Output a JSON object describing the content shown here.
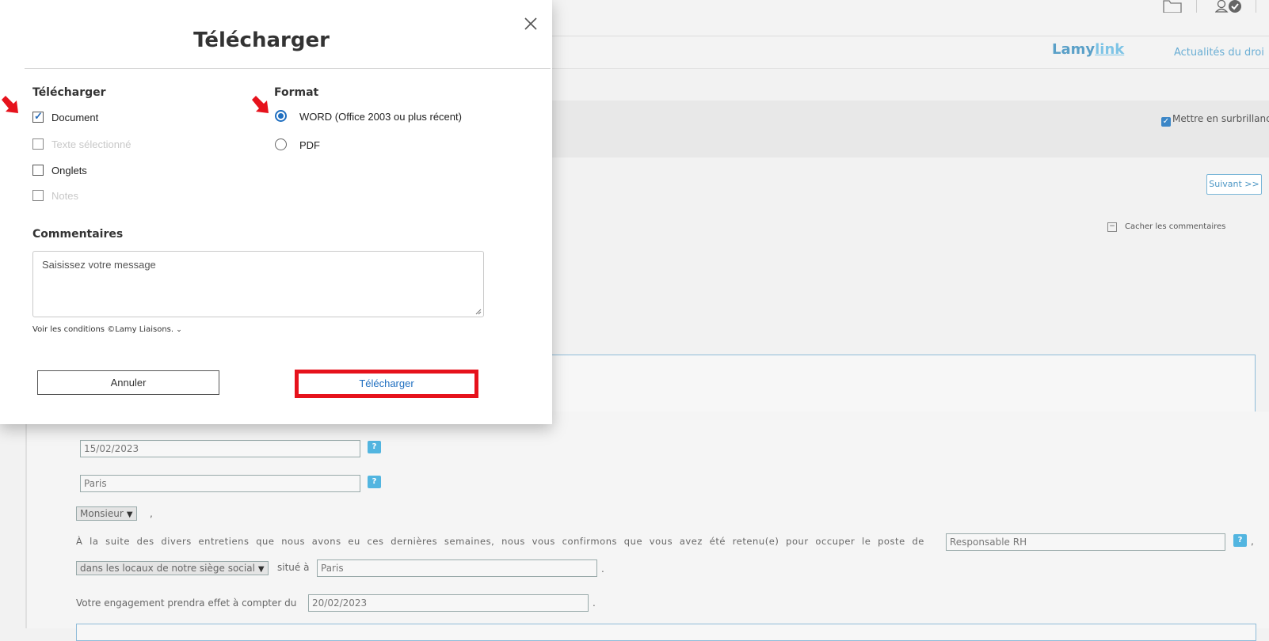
{
  "modal": {
    "title": "Télécharger",
    "download_section": {
      "label": "Télécharger",
      "options": [
        {
          "label": "Document",
          "checked": true,
          "disabled": false
        },
        {
          "label": "Texte sélectionné",
          "checked": false,
          "disabled": true
        },
        {
          "label": "Onglets",
          "checked": false,
          "disabled": false
        },
        {
          "label": "Notes",
          "checked": false,
          "disabled": true
        }
      ]
    },
    "format_section": {
      "label": "Format",
      "options": [
        {
          "label": "WORD (Office 2003 ou plus récent)",
          "selected": true
        },
        {
          "label": "PDF",
          "selected": false
        }
      ]
    },
    "comments": {
      "label": "Commentaires",
      "placeholder": "Saisissez votre message"
    },
    "conditions_link": "Voir les conditions ©Lamy Liaisons.",
    "cancel_label": "Annuler",
    "download_label": "Télécharger",
    "highlight_color": "#e6121c",
    "arrow_color": "#e6121c"
  },
  "header": {
    "brand_main": "Lamy",
    "brand_link": "link",
    "news_link": "Actualités du droi"
  },
  "toolbar": {
    "highlight_label": "Mettre en surbrillanc",
    "next_button": "Suivant >>",
    "hide_comments": "Cacher les commentaires"
  },
  "document": {
    "date_value": "15/02/2023",
    "city_value": "Paris",
    "salutation": "Monsieur",
    "salutation_comma": ",",
    "help_glyph": "?",
    "sentence": "À la suite des divers entretiens que nous avons eu ces dernières semaines, nous vous confirmons que vous avez été retenu(e) pour occuper le poste de",
    "position_value": "Responsable RH",
    "trailing_comma": ",",
    "location_select": "dans les locaux de notre siège social",
    "located_at": "situé à",
    "location_city": "Paris",
    "period": ".",
    "start_text": "Votre engagement prendra effet à compter du",
    "start_date": "20/02/2023"
  }
}
